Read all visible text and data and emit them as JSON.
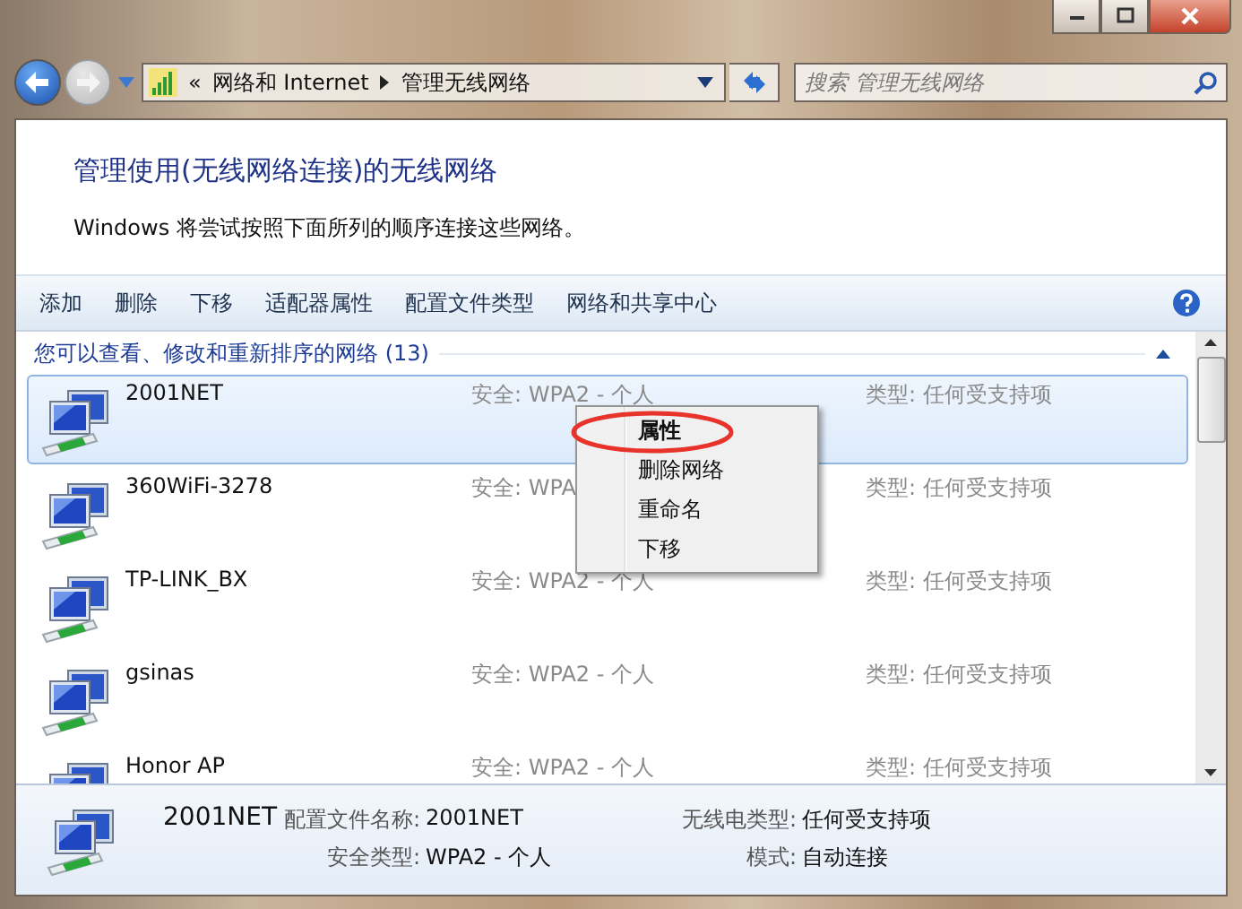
{
  "address_bar": {
    "overflow": "«",
    "path": [
      {
        "label": "网络和 Internet"
      },
      {
        "label": "管理无线网络"
      }
    ]
  },
  "search": {
    "placeholder": "搜索 管理无线网络"
  },
  "header": {
    "title": "管理使用(无线网络连接)的无线网络",
    "description": "Windows 将尝试按照下面所列的顺序连接这些网络。"
  },
  "toolbar": [
    "添加",
    "删除",
    "下移",
    "适配器属性",
    "配置文件类型",
    "网络和共享中心"
  ],
  "group": {
    "label": "您可以查看、修改和重新排序的网络 (13)",
    "expanded": true
  },
  "networks": [
    {
      "name": "2001NET",
      "security": "安全: WPA2 - 个人",
      "type": "类型: 任何受支持项",
      "selected": true
    },
    {
      "name": "360WiFi-3278",
      "security": "安全: WPA",
      "type": "类型: 任何受支持项",
      "selected": false
    },
    {
      "name": "TP-LINK_BX",
      "security": "安全: WPA2 - 个人",
      "type": "类型: 任何受支持项",
      "selected": false
    },
    {
      "name": "gsinas",
      "security": "安全: WPA2 - 个人",
      "type": "类型: 任何受支持项",
      "selected": false
    },
    {
      "name": "Honor AP",
      "security": "安全: WPA2 - 个人",
      "type": "类型: 任何受支持项",
      "selected": false
    }
  ],
  "context_menu": {
    "items": [
      {
        "label": "属性",
        "default": true,
        "circled": true
      },
      {
        "label": "删除网络",
        "default": false,
        "circled": false
      },
      {
        "label": "重命名",
        "default": false,
        "circled": false
      },
      {
        "label": "下移",
        "default": false,
        "circled": false
      }
    ]
  },
  "details": {
    "name": "2001NET",
    "fields": [
      {
        "label": "配置文件名称:",
        "value": "2001NET"
      },
      {
        "label": "无线电类型:",
        "value": "任何受支持项"
      },
      {
        "label": "安全类型:",
        "value": "WPA2 - 个人"
      },
      {
        "label": "模式:",
        "value": "自动连接"
      }
    ]
  }
}
